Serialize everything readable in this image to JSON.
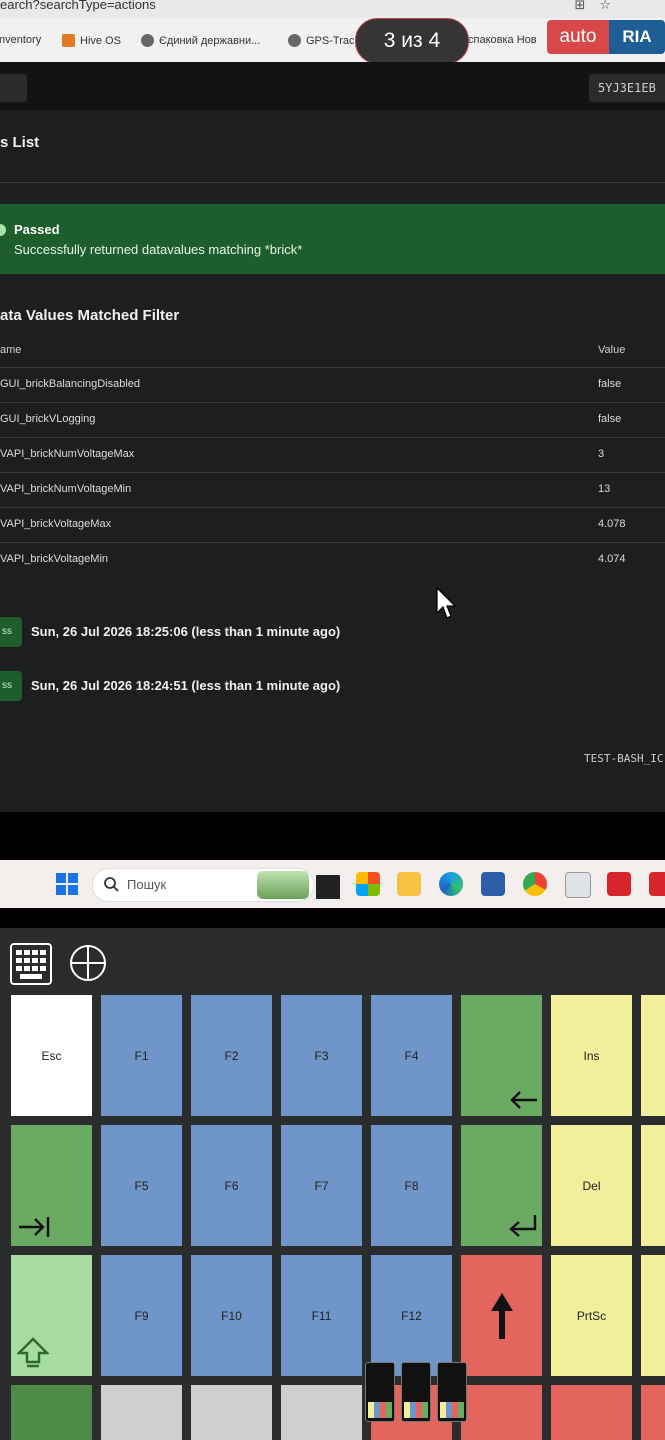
{
  "browser": {
    "url_fragment": "earch?searchType=actions",
    "bookmarks": [
      {
        "label": "nventory"
      },
      {
        "label": "Hive OS"
      },
      {
        "label": "Єдиний державни..."
      },
      {
        "label": "GPS-Trac"
      },
      {
        "label": "спаковка Нов"
      }
    ]
  },
  "viewer": {
    "pager": "3 из 4",
    "logo_auto": "auto",
    "logo_ria": "RIA"
  },
  "app": {
    "vin": "5YJ3E1EB",
    "list_title": "s List",
    "alert": {
      "title": "Passed",
      "message": "Successfully returned datavalues matching *brick*",
      "color": "#1d5e2c"
    },
    "table": {
      "title": "ata Values Matched Filter",
      "col_name": "ame",
      "col_value": "Value",
      "rows": [
        {
          "name": "GUI_brickBalancingDisabled",
          "value": "false"
        },
        {
          "name": "GUI_brickVLogging",
          "value": "false"
        },
        {
          "name": "VAPI_brickNumVoltageMax",
          "value": "3"
        },
        {
          "name": "VAPI_brickNumVoltageMin",
          "value": "13"
        },
        {
          "name": "VAPI_brickVoltageMax",
          "value": "4.078"
        },
        {
          "name": "VAPI_brickVoltageMin",
          "value": "4.074"
        }
      ]
    },
    "history": [
      {
        "badge": "ss",
        "time": "Sun, 26 Jul 2026 18:25:06 (less than 1 minute ago)"
      },
      {
        "badge": "ss",
        "time": "Sun, 26 Jul 2026 18:24:51 (less than 1 minute ago)"
      }
    ],
    "test_id": "TEST-BASH_IC"
  },
  "taskbar": {
    "search_placeholder": "Пошук"
  },
  "keypad": {
    "keys": [
      {
        "label": "Esc",
        "color": "white"
      },
      {
        "label": "F1",
        "color": "blue"
      },
      {
        "label": "F2",
        "color": "blue"
      },
      {
        "label": "F3",
        "color": "blue"
      },
      {
        "label": "F4",
        "color": "blue"
      },
      {
        "label": "",
        "color": "green",
        "icon": "backspace-arrow-icon"
      },
      {
        "label": "Ins",
        "color": "yellow"
      },
      {
        "label": "",
        "color": "green",
        "icon": "tab-arrow-icon"
      },
      {
        "label": "F5",
        "color": "blue"
      },
      {
        "label": "F6",
        "color": "blue"
      },
      {
        "label": "F7",
        "color": "blue"
      },
      {
        "label": "F8",
        "color": "blue"
      },
      {
        "label": "",
        "color": "green",
        "icon": "enter-arrow-icon"
      },
      {
        "label": "Del",
        "color": "yellow"
      },
      {
        "label": "",
        "color": "lgreen",
        "icon": "shift-arrow-icon"
      },
      {
        "label": "F9",
        "color": "blue"
      },
      {
        "label": "F10",
        "color": "blue"
      },
      {
        "label": "F11",
        "color": "blue"
      },
      {
        "label": "F12",
        "color": "blue"
      },
      {
        "label": "",
        "color": "red",
        "icon": "up-arrow-icon"
      },
      {
        "label": "PrtSc",
        "color": "yellow"
      }
    ]
  }
}
